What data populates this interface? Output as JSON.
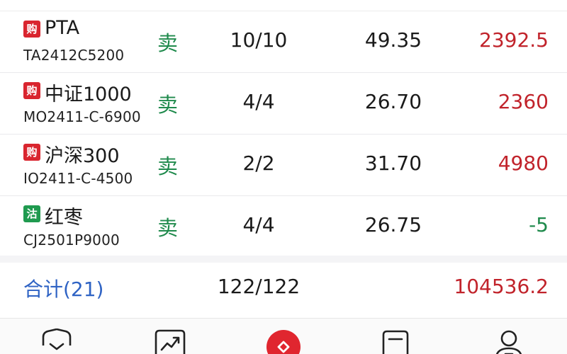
{
  "rows": [
    {
      "badge": "购",
      "badge_color": "#d9252f",
      "name": "PTA",
      "code": "TA2412C5200",
      "direction": "卖",
      "quantity": "10/10",
      "price": "49.35",
      "pnl": "2392.5",
      "pnl_color": "#c1232b"
    },
    {
      "badge": "购",
      "badge_color": "#d9252f",
      "name": "中证1000",
      "code": "MO2411-C-6900",
      "direction": "卖",
      "quantity": "4/4",
      "price": "26.70",
      "pnl": "2360",
      "pnl_color": "#c1232b"
    },
    {
      "badge": "购",
      "badge_color": "#d9252f",
      "name": "沪深300",
      "code": "IO2411-C-4500",
      "direction": "卖",
      "quantity": "2/2",
      "price": "31.70",
      "pnl": "4980",
      "pnl_color": "#c1232b"
    },
    {
      "badge": "沽",
      "badge_color": "#1f9a4f",
      "name": "红枣",
      "code": "CJ2501P9000",
      "direction": "卖",
      "quantity": "4/4",
      "price": "26.75",
      "pnl": "-5",
      "pnl_color": "#1f8a4c"
    }
  ],
  "total": {
    "label": "合计(21)",
    "quantity": "122/122",
    "pnl": "104536.2"
  },
  "tabbar": {
    "icons": [
      "shield-check-icon",
      "trend-chart-icon",
      "trade-center-icon",
      "document-icon",
      "person-icon"
    ],
    "accent": "#e0262f"
  }
}
